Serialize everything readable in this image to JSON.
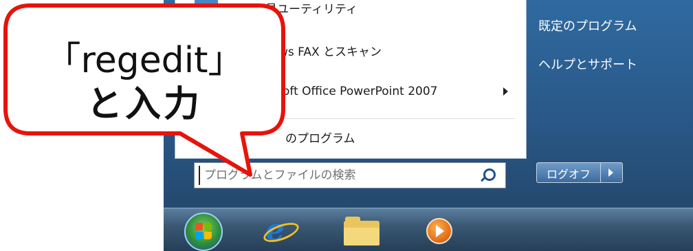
{
  "start_menu": {
    "programs": [
      {
        "label": "のぞき見ユーティリティ",
        "has_submenu": false
      },
      {
        "label": "ws FAX とスキャン",
        "has_submenu": false
      },
      {
        "label": "oft Office PowerPoint 2007",
        "has_submenu": true
      },
      {
        "label": "のプログラム",
        "has_submenu": false
      }
    ],
    "search": {
      "placeholder": "プログラムとファイルの検索",
      "value": ""
    },
    "right_links": [
      "既定のプログラム",
      "ヘルプとサポート"
    ],
    "logoff_label": "ログオフ"
  },
  "callout": {
    "line1": "「regedit」",
    "line2": "と入力"
  },
  "taskbar": {
    "icons": [
      "windows-start-orb-icon",
      "internet-explorer-icon",
      "explorer-folder-icon",
      "media-player-icon"
    ]
  },
  "colors": {
    "bubble_border": "#e8130a",
    "start_menu_blue": "#2b5c8e",
    "taskbar": "#2e4a66"
  }
}
